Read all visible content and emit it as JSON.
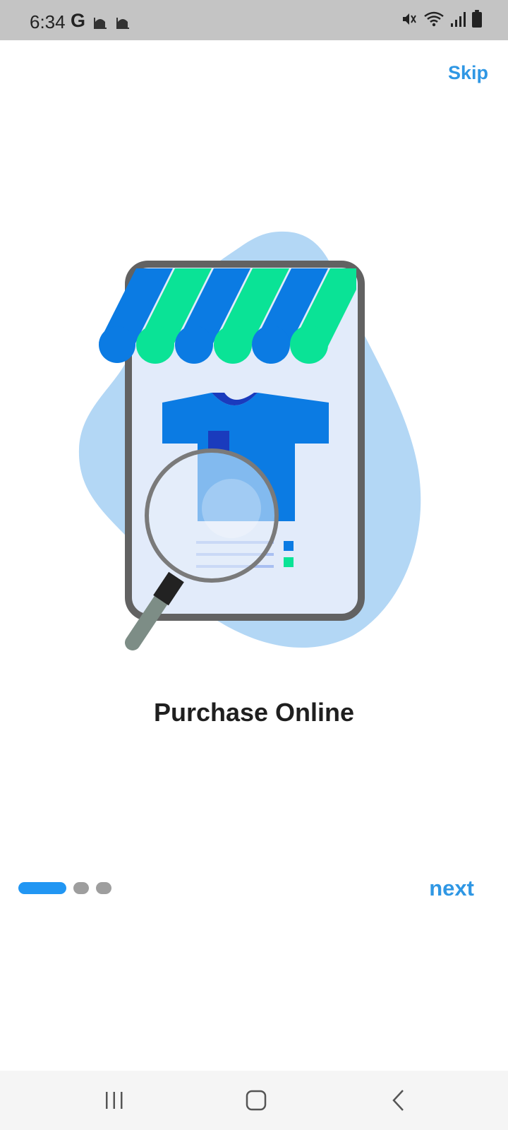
{
  "status_bar": {
    "time": "6:34",
    "google_letter": "G",
    "left_icons": [
      "mosque-icon",
      "mosque-icon"
    ],
    "right_icons": [
      "mute-icon",
      "wifi-icon",
      "signal-icon",
      "battery-icon"
    ]
  },
  "header": {
    "skip_label": "Skip"
  },
  "onboarding": {
    "title": "Purchase Online",
    "illustration": "shop-search-illustration",
    "page_index": 1,
    "page_count": 3,
    "next_label": "next"
  },
  "nav_bar": {
    "items": [
      "recents-icon",
      "home-icon",
      "back-icon"
    ]
  },
  "colors": {
    "accent": "#2196f3",
    "link": "#2f97e4",
    "awning_blue": "#0b7be3",
    "awning_green": "#0ae396",
    "blob": "#b3d7f5"
  }
}
